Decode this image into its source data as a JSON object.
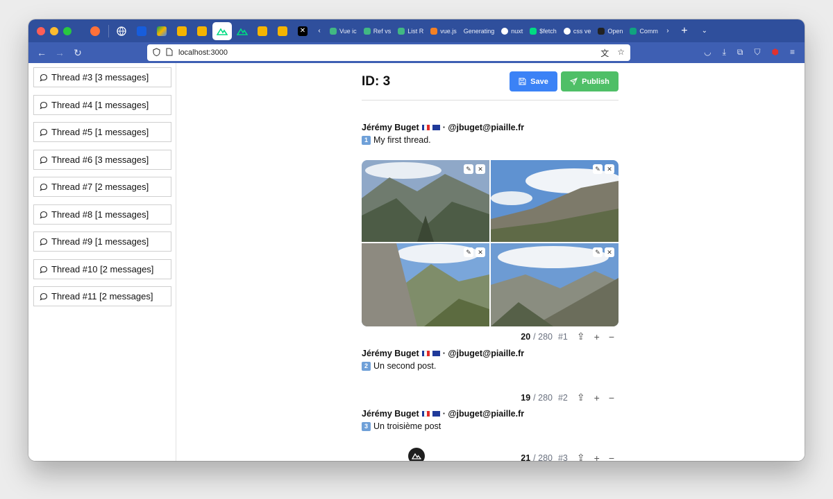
{
  "browser": {
    "tabs": [
      {
        "label": "Vue ic",
        "fav": "#41b883"
      },
      {
        "label": "Ref vs",
        "fav": "#41b883"
      },
      {
        "label": "List R",
        "fav": "#41b883"
      },
      {
        "label": "vue.js",
        "fav": "#f48024"
      },
      {
        "label": "Generating",
        "fav": "#888"
      },
      {
        "label": "nuxt",
        "fav": "#ffffff"
      },
      {
        "label": "$fetch",
        "fav": "#00dc82"
      },
      {
        "label": "css ve",
        "fav": "#ffffff"
      },
      {
        "label": "Open",
        "fav": "#222"
      },
      {
        "label": "Comm",
        "fav": "#10a37f"
      }
    ],
    "url": "localhost:3000"
  },
  "sidebar": {
    "items": [
      {
        "label": "Thread #3 [3 messages]"
      },
      {
        "label": "Thread #4 [1 messages]"
      },
      {
        "label": "Thread #5 [1 messages]"
      },
      {
        "label": "Thread #6 [3 messages]"
      },
      {
        "label": "Thread #7 [2 messages]"
      },
      {
        "label": "Thread #8 [1 messages]"
      },
      {
        "label": "Thread #9 [1 messages]"
      },
      {
        "label": "Thread #10 [2 messages]"
      },
      {
        "label": "Thread #11 [2 messages]"
      }
    ]
  },
  "main": {
    "title": "ID: 3",
    "save_label": "Save",
    "publish_label": "Publish",
    "posts": [
      {
        "author": "Jérémy Buget",
        "handle": "· @jbuget@piaille.fr",
        "number": "1",
        "text": "My first thread.",
        "count": "20",
        "max": "/ 280",
        "index": "#1"
      },
      {
        "author": "Jérémy Buget",
        "handle": "· @jbuget@piaille.fr",
        "number": "2",
        "text": "Un second post.",
        "count": "19",
        "max": "/ 280",
        "index": "#2"
      },
      {
        "author": "Jérémy Buget",
        "handle": "· @jbuget@piaille.fr",
        "number": "3",
        "text": "Un troisième post",
        "count": "21",
        "max": "/ 280",
        "index": "#3"
      }
    ]
  },
  "colors": {
    "accent_blue": "#3b82f6",
    "accent_green": "#4fbf67",
    "chrome": "#2f4f9c"
  }
}
